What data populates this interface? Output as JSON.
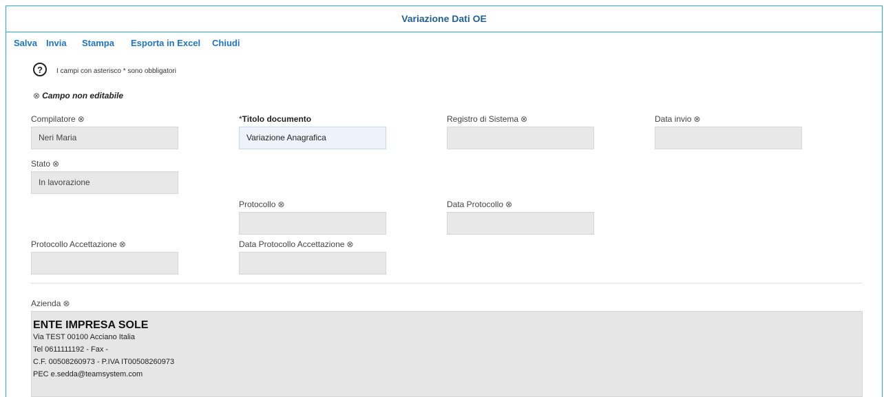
{
  "window": {
    "title": "Variazione Dati OE"
  },
  "toolbar": {
    "save": "Salva",
    "send": "Invia",
    "print": "Stampa",
    "export": "Esporta in Excel",
    "close": "Chiudi"
  },
  "help": {
    "icon_text": "?",
    "text": "I campi con asterisco * sono obbligatori"
  },
  "legend": {
    "icon": "⊗",
    "text": "Campo non editabile"
  },
  "fields": {
    "compilatore": {
      "label": "Compilatore",
      "value": "Neri Maria"
    },
    "titolo": {
      "required_mark": "*",
      "label": "Titolo documento",
      "value": "Variazione Anagrafica"
    },
    "registro": {
      "label": "Registro di Sistema",
      "value": ""
    },
    "data_invio": {
      "label": "Data invio",
      "value": ""
    },
    "stato": {
      "label": "Stato",
      "value": "In lavorazione"
    },
    "protocollo": {
      "label": "Protocollo",
      "value": ""
    },
    "data_protocollo": {
      "label": "Data Protocollo",
      "value": ""
    },
    "protocollo_accettazione": {
      "label": "Protocollo Accettazione",
      "value": ""
    },
    "data_protocollo_accettazione": {
      "label": "Data Protocollo Accettazione",
      "value": ""
    }
  },
  "azienda": {
    "label": "Azienda",
    "name": "ENTE IMPRESA SOLE",
    "address": "Via TEST 00100 Acciano Italia",
    "phone": "Tel 0611111192 - Fax -",
    "tax": "C.F. 00508260973 - P.IVA IT00508260973",
    "pec": "PEC e.sedda@teamsystem.com"
  },
  "icons": {
    "not_editable": "⊗"
  },
  "colors": {
    "accent": "#2aa7de",
    "title": "#1f5f95",
    "link": "#1f74c6",
    "readonly_bg": "#e8e8e8",
    "editable_bg": "#eef3fb"
  }
}
